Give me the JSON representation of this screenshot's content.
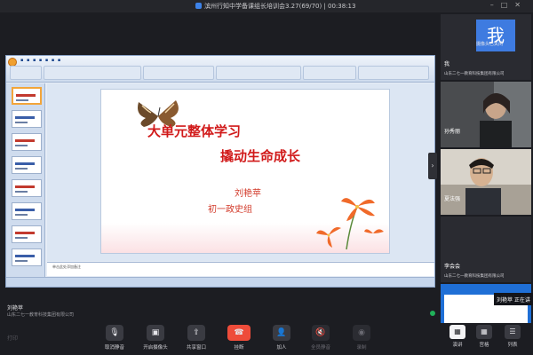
{
  "window": {
    "title": "滨州行知中学备课组长培训会3.27(69/70) | 00:38:13"
  },
  "slide": {
    "title_line1": "大单元整体学习",
    "title_line2": "撬动生命成长",
    "presenter": "刘艳苹",
    "group": "初一政史组",
    "notes_placeholder": "单击此处添加备注"
  },
  "speaker": {
    "name": "刘艳苹",
    "org": "山东二七一教育科技集团有限公司"
  },
  "participants": [
    {
      "name": "我",
      "org": "山东二七一教育科技集团有限公司",
      "avatar_text": "我",
      "video_label": "摄像头已关闭"
    },
    {
      "name": "孙秀丽",
      "org": ""
    },
    {
      "name": "夏法强",
      "org": ""
    },
    {
      "name": "李会会",
      "org": "山东二七一教育科技集团有限公司"
    },
    {
      "name": "",
      "org": ""
    }
  ],
  "tooltip": "刘艳苹 正在讲",
  "toolbar": {
    "signal": "打印",
    "buttons": [
      {
        "label": "取消静音",
        "icon": "mic-muted-icon"
      },
      {
        "label": "开启摄像头",
        "icon": "camera-off-icon"
      },
      {
        "label": "共享窗口",
        "icon": "share-screen-icon"
      },
      {
        "label": "挂断",
        "icon": "hangup-icon"
      },
      {
        "label": "加人",
        "icon": "add-user-icon"
      },
      {
        "label": "全员静音",
        "icon": "mute-all-icon"
      },
      {
        "label": "录制",
        "icon": "record-icon"
      }
    ],
    "right": [
      {
        "label": "演讲",
        "icon": "speaker-view-icon"
      },
      {
        "label": "宫格",
        "icon": "grid-view-icon"
      },
      {
        "label": "列表",
        "icon": "list-view-icon"
      }
    ]
  },
  "colors": {
    "accent": "#3e7be0",
    "hangup": "#ee4c3a",
    "slide_red": "#d11a1a"
  }
}
